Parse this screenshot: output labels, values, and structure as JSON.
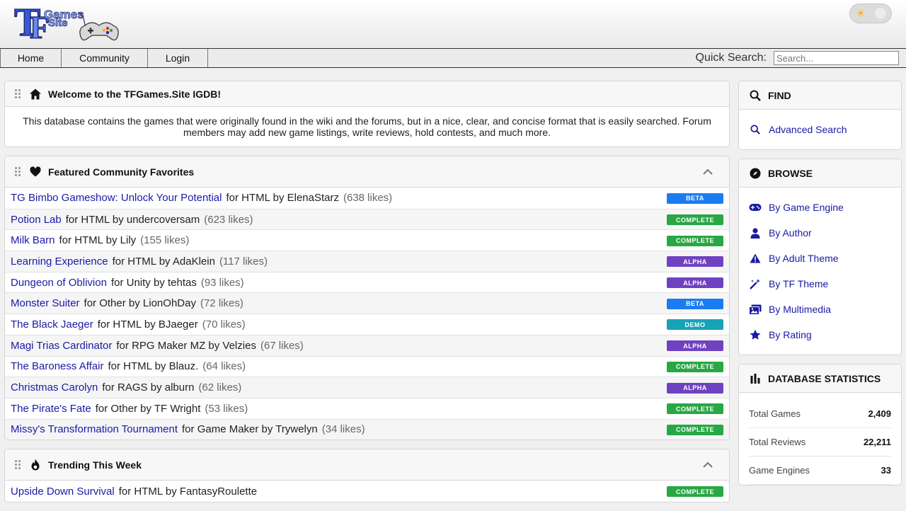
{
  "header": {
    "logo_text": "TF Games Site",
    "theme_icon": "sun-icon"
  },
  "nav": {
    "home": "Home",
    "community": "Community",
    "login": "Login",
    "quick_search_label": "Quick Search:",
    "search_placeholder": "Search..."
  },
  "welcome": {
    "title": "Welcome to the TFGames.Site IGDB!",
    "body": "This database contains the games that were originally found in the wiki and the forums, but in a nice, clear, and concise format that is easily searched. Forum members may add new game listings, write reviews, hold contests, and much more."
  },
  "featured": {
    "title": "Featured Community Favorites",
    "games": [
      {
        "title": "TG Bimbo Gameshow: Unlock Your Potential",
        "meta": "for HTML by ElenaStarz",
        "likes": "(638 likes)",
        "status": "BETA"
      },
      {
        "title": "Potion Lab",
        "meta": "for HTML by undercoversam",
        "likes": "(623 likes)",
        "status": "COMPLETE"
      },
      {
        "title": "Milk Barn",
        "meta": "for HTML by Lily",
        "likes": "(155 likes)",
        "status": "COMPLETE"
      },
      {
        "title": "Learning Experience",
        "meta": "for HTML by AdaKlein",
        "likes": "(117 likes)",
        "status": "ALPHA"
      },
      {
        "title": "Dungeon of Oblivion",
        "meta": "for Unity by tehtas",
        "likes": "(93 likes)",
        "status": "ALPHA"
      },
      {
        "title": "Monster Suiter",
        "meta": "for Other by LionOhDay",
        "likes": "(72 likes)",
        "status": "BETA"
      },
      {
        "title": "The Black Jaeger",
        "meta": "for HTML by BJaeger",
        "likes": "(70 likes)",
        "status": "DEMO"
      },
      {
        "title": "Magi Trias Cardinator",
        "meta": "for RPG Maker MZ by Velzies",
        "likes": "(67 likes)",
        "status": "ALPHA"
      },
      {
        "title": "The Baroness Affair",
        "meta": "for HTML by Blauz.",
        "likes": "(64 likes)",
        "status": "COMPLETE"
      },
      {
        "title": "Christmas Carolyn",
        "meta": "for RAGS by alburn",
        "likes": "(62 likes)",
        "status": "ALPHA"
      },
      {
        "title": "The Pirate's Fate",
        "meta": "for Other by TF Wright",
        "likes": "(53 likes)",
        "status": "COMPLETE"
      },
      {
        "title": "Missy's Transformation Tournament",
        "meta": "for Game Maker by Trywelyn",
        "likes": "(34 likes)",
        "status": "COMPLETE"
      }
    ]
  },
  "trending": {
    "title": "Trending This Week",
    "games": [
      {
        "title": "Upside Down Survival",
        "meta": "for HTML by FantasyRoulette",
        "likes": "",
        "status": "COMPLETE"
      }
    ]
  },
  "find": {
    "title": "FIND",
    "items": [
      {
        "label": "Advanced Search",
        "icon": "search-icon"
      }
    ]
  },
  "browse": {
    "title": "BROWSE",
    "items": [
      {
        "label": "By Game Engine",
        "icon": "gamepad-icon"
      },
      {
        "label": "By Author",
        "icon": "user-icon"
      },
      {
        "label": "By Adult Theme",
        "icon": "warning-icon"
      },
      {
        "label": "By TF Theme",
        "icon": "magic-wand-icon"
      },
      {
        "label": "By Multimedia",
        "icon": "images-icon"
      },
      {
        "label": "By Rating",
        "icon": "star-icon"
      }
    ]
  },
  "stats": {
    "title": "DATABASE STATISTICS",
    "rows": [
      {
        "label": "Total Games",
        "value": "2,409"
      },
      {
        "label": "Total Reviews",
        "value": "22,211"
      },
      {
        "label": "Game Engines",
        "value": "33"
      }
    ]
  },
  "colors": {
    "link": "#1a1aa6",
    "beta": "#1b7cf2",
    "complete": "#28a745",
    "alpha": "#6f42c1",
    "demo": "#17a2b8"
  }
}
